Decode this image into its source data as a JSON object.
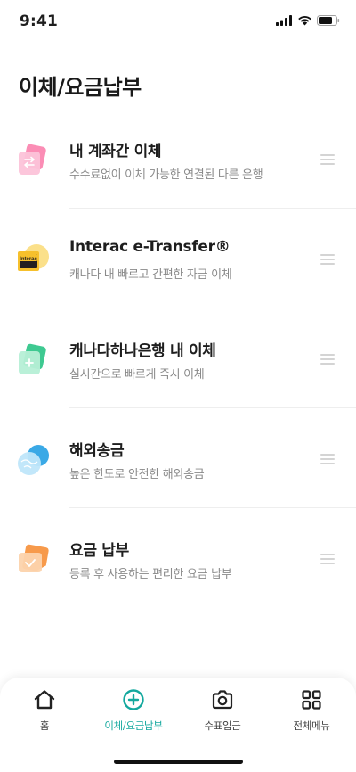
{
  "status_bar": {
    "time": "9:41"
  },
  "page": {
    "title": "이체/요금납부"
  },
  "menu_items": [
    {
      "id": "between-accounts",
      "title": "내 계좌간 이체",
      "subtitle": "수수료없이 이체 가능한 연결된 다른 은행",
      "icon": "account-transfer-icon"
    },
    {
      "id": "interac",
      "title": "Interac e-Transfer®",
      "subtitle": "캐나다 내 빠르고 간편한 자금 이체",
      "icon": "interac-logo-icon",
      "icon_text": "Interac"
    },
    {
      "id": "hana-canada",
      "title": "캐나다하나은행 내 이체",
      "subtitle": "실시간으로 빠르게 즉시 이체",
      "icon": "hana-bank-transfer-icon"
    },
    {
      "id": "overseas",
      "title": "해외송금",
      "subtitle": "높은 한도로 안전한 해외송금",
      "icon": "overseas-remittance-icon"
    },
    {
      "id": "bill-pay",
      "title": "요금 납부",
      "subtitle": "등록 후 사용하는 편리한 요금 납부",
      "icon": "bill-payment-icon"
    }
  ],
  "tab_bar": {
    "tabs": [
      {
        "label": "홈",
        "icon": "home-icon",
        "active": false
      },
      {
        "label": "이체/요금납부",
        "icon": "transfer-plus-icon",
        "active": true
      },
      {
        "label": "수표입금",
        "icon": "camera-icon",
        "active": false
      },
      {
        "label": "전체메뉴",
        "icon": "grid-menu-icon",
        "active": false
      }
    ]
  },
  "colors": {
    "accent": "#13a89e",
    "pink": "#f7a8c4",
    "interac_yellow": "#f6c02c",
    "green": "#4fd1a0",
    "blue": "#56b8ea",
    "orange": "#f7a662"
  }
}
